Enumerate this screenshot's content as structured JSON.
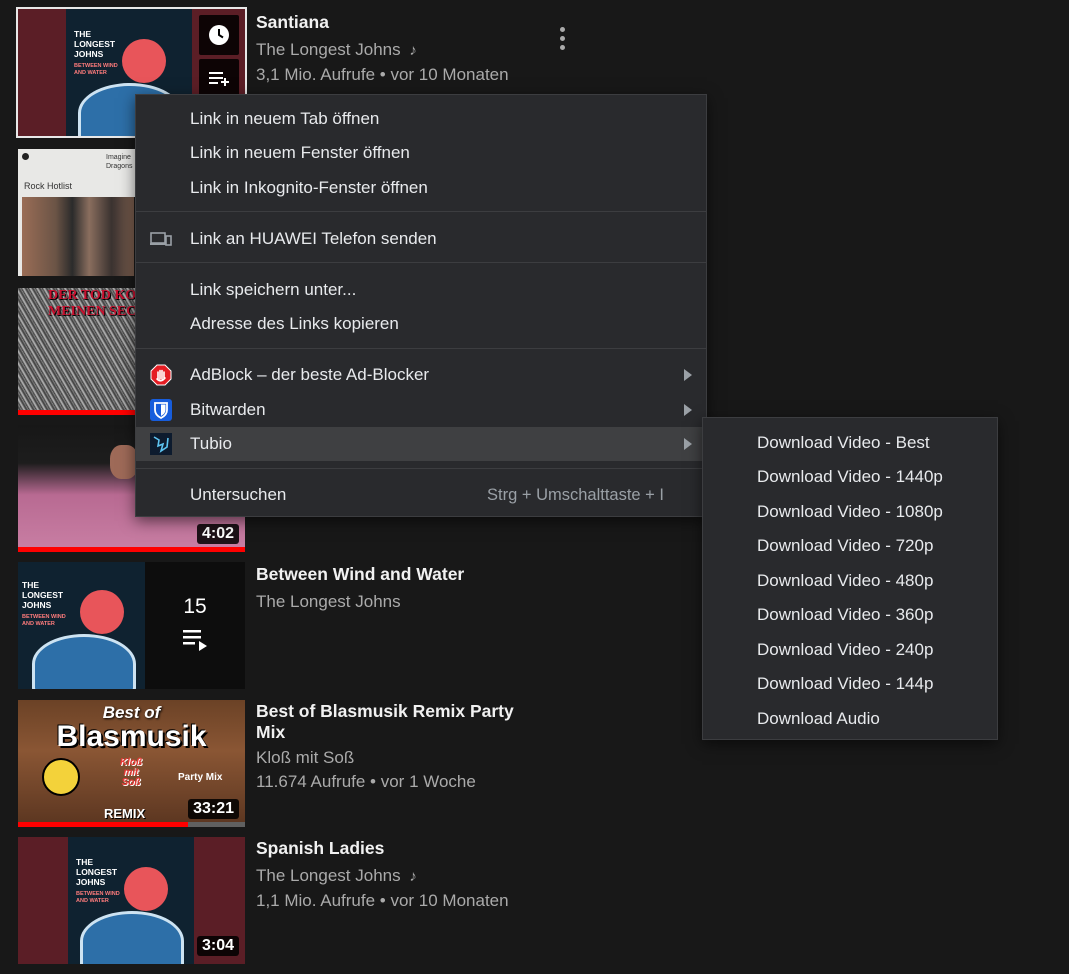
{
  "videos": [
    {
      "title": "Santiana",
      "channel": "The Longest Johns",
      "music": true,
      "stats": "3,1 Mio. Aufrufe • vor 10 Monaten",
      "art_title": "THE\nLONGEST\nJOHNS",
      "art_subtitle": "BETWEEN WIND\nAND WATER"
    },
    {
      "art_label": "Rock Hotlist",
      "art_artist": "Imagine\nDragons"
    },
    {
      "art_banner": "DER TOD KOMMT\nMEINEN SECH…"
    },
    {
      "duration": "4:02"
    },
    {
      "title": "Between Wind and Water",
      "channel": "The Longest Johns",
      "playlist_count": "15",
      "art_title": "THE\nLONGEST\nJOHNS",
      "art_subtitle": "BETWEEN WIND\nAND WATER"
    },
    {
      "title": "Best of Blasmusik Remix Party Mix",
      "channel": "Kloß mit Soß",
      "stats": "11.674 Aufrufe • vor 1 Woche",
      "duration": "33:21",
      "watched_fraction": 0.75,
      "art_top": "Best of",
      "art_main": "Blasmusik",
      "art_brand": "Kloß\nmit\nSoß",
      "art_party": "Party Mix",
      "art_remix": "REMIX"
    },
    {
      "title": "Spanish Ladies",
      "channel": "The Longest Johns",
      "music": true,
      "stats": "1,1 Mio. Aufrufe • vor 10 Monaten",
      "duration": "3:04",
      "art_title": "THE\nLONGEST\nJOHNS",
      "art_subtitle": "BETWEEN WIND\nAND WATER"
    }
  ],
  "context_menu": {
    "open_new_tab": "Link in neuem Tab öffnen",
    "open_new_window": "Link in neuem Fenster öffnen",
    "open_incognito": "Link in Inkognito-Fenster öffnen",
    "send_to_device": "Link an HUAWEI Telefon senden",
    "save_link": "Link speichern unter...",
    "copy_address": "Adresse des Links kopieren",
    "adblock": "AdBlock – der beste Ad-Blocker",
    "bitwarden": "Bitwarden",
    "tubio": "Tubio",
    "inspect": "Untersuchen",
    "inspect_shortcut": "Strg + Umschalttaste + I"
  },
  "tubio_submenu": [
    "Download Video - Best",
    "Download Video - 1440p",
    "Download Video - 1080p",
    "Download Video - 720p",
    "Download Video - 480p",
    "Download Video - 360p",
    "Download Video - 240p",
    "Download Video - 144p",
    "Download Audio"
  ],
  "colors": {
    "menu_bg": "#292a2d",
    "menu_hover": "#3f4042",
    "progress_red": "#ff0000",
    "adblock_red": "#e51c23",
    "bitwarden_blue": "#175ddc"
  }
}
